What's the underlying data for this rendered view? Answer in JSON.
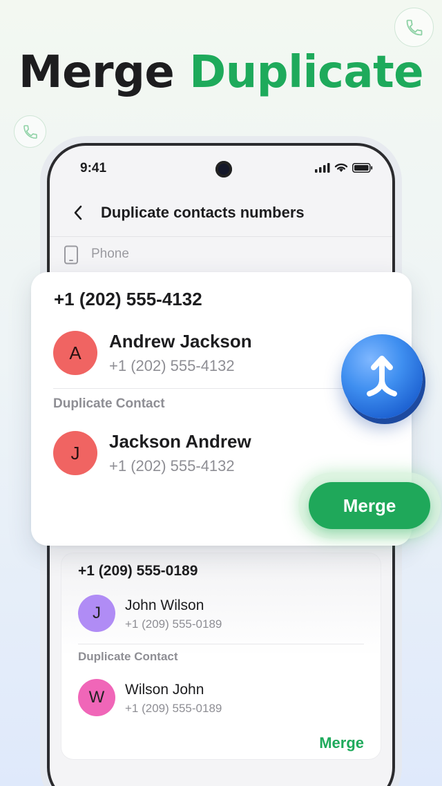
{
  "headline": {
    "part1": "Merge",
    "part2": "Duplicate"
  },
  "status_bar": {
    "time": "9:41"
  },
  "app_bar": {
    "title": "Duplicate contacts numbers"
  },
  "filter": {
    "label": "Phone"
  },
  "featured_group": {
    "number": "+1 (202) 555-4132",
    "primary": {
      "initial": "A",
      "name": "Andrew Jackson",
      "phone": "+1 (202) 555-4132"
    },
    "duplicate_label": "Duplicate Contact",
    "duplicate": {
      "initial": "J",
      "name": "Jackson Andrew",
      "phone": "+1 (202) 555-4132"
    },
    "merge_label": "Merge"
  },
  "second_group": {
    "number": "+1 (209) 555-0189",
    "primary": {
      "initial": "J",
      "name": "John Wilson",
      "phone": "+1 (209) 555-0189"
    },
    "duplicate_label": "Duplicate Contact",
    "duplicate": {
      "initial": "W",
      "name": "Wilson John",
      "phone": "+1 (209) 555-0189"
    },
    "merge_label": "Merge"
  },
  "colors": {
    "accent": "#1eaa5b",
    "avatar_red": "#f06462",
    "avatar_purple": "#b08cf5",
    "avatar_pink": "#f066b8",
    "orb_blue": "#3f8ff0"
  },
  "icons": [
    "phone-call-icon",
    "back-chevron-icon",
    "signal-icon",
    "wifi-icon",
    "battery-icon",
    "smartphone-icon",
    "merge-arrow-icon"
  ]
}
